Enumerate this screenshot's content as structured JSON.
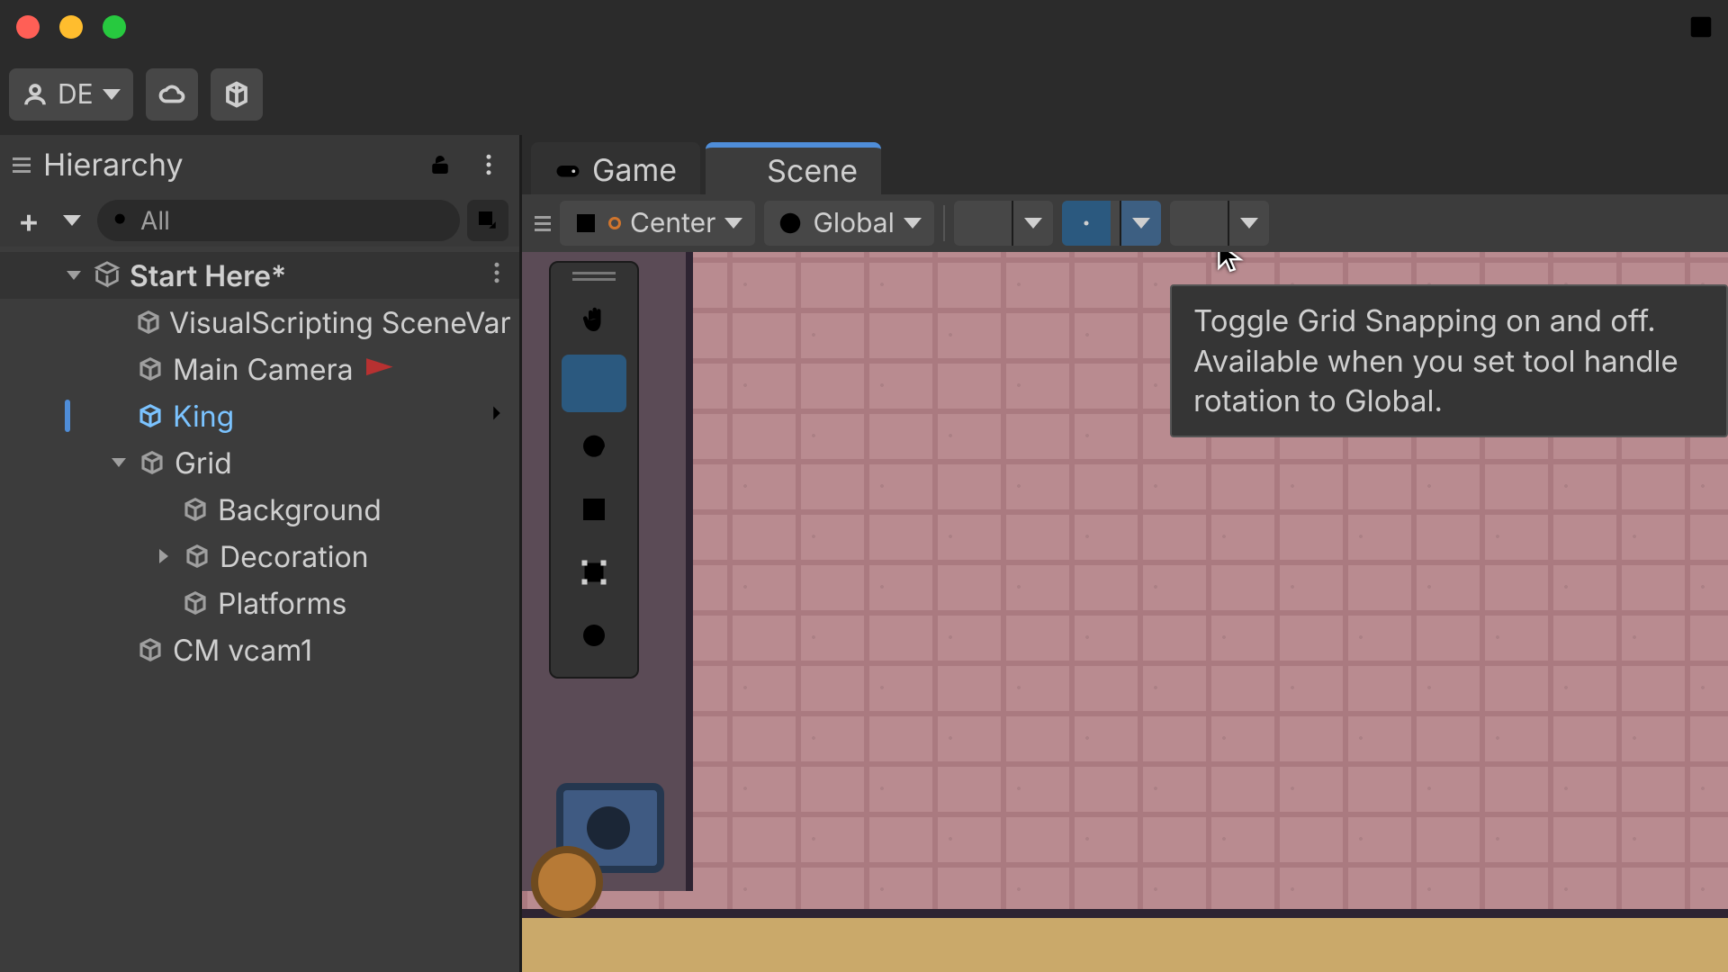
{
  "toolbar": {
    "account_label": "DE"
  },
  "hierarchy": {
    "panel_title": "Hierarchy",
    "search_label": "All",
    "scene_name": "Start Here*",
    "items": [
      {
        "label": "VisualScripting SceneVariables"
      },
      {
        "label": "Main Camera"
      },
      {
        "label": "King"
      },
      {
        "label": "Grid"
      },
      {
        "label": "Background"
      },
      {
        "label": "Decoration"
      },
      {
        "label": "Platforms"
      },
      {
        "label": "CM vcam1"
      }
    ]
  },
  "scene": {
    "tabs": {
      "game": "Game",
      "scene": "Scene"
    },
    "pivot_mode": "Center",
    "rotation_mode": "Global",
    "tooltip": "Toggle Grid Snapping on and off. Available when you set tool handle rotation to Global."
  }
}
